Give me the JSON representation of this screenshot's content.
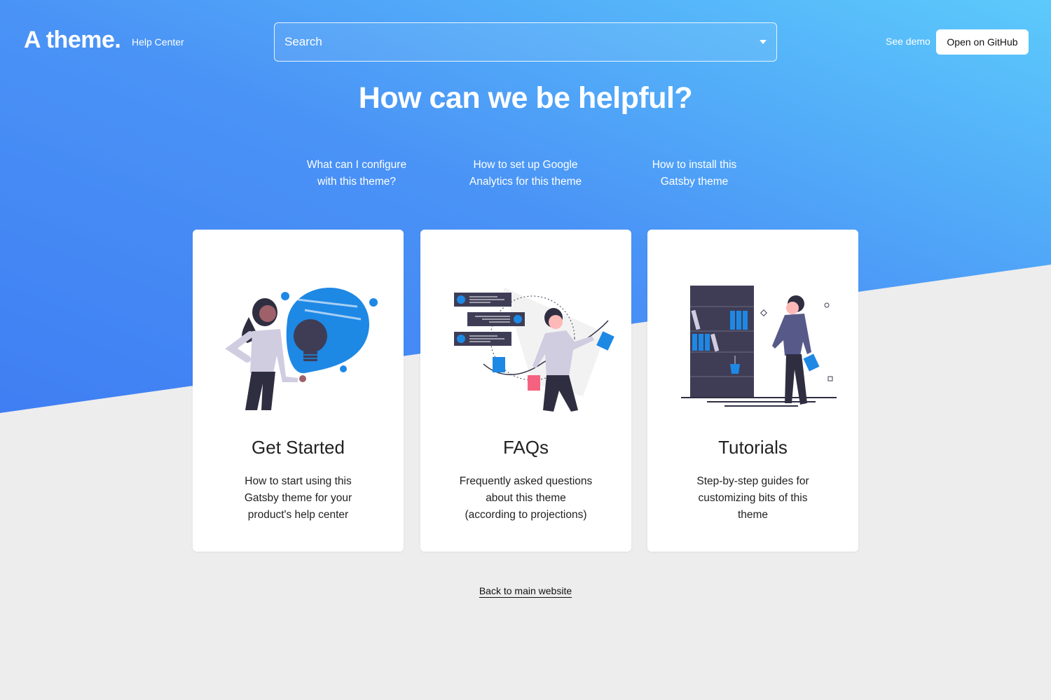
{
  "header": {
    "logo": "A theme.",
    "logo_sub": "Help Center",
    "search_placeholder": "Search",
    "see_demo": "See demo",
    "github_button": "Open on GitHub"
  },
  "hero": {
    "headline": "How can we be helpful?",
    "popular_links": [
      "What can I configure with this theme?",
      "How to set up Google Analytics for this theme",
      "How to install this Gatsby theme"
    ]
  },
  "cards": [
    {
      "title": "Get Started",
      "description": "How to start using this Gatsby theme for your product's help center"
    },
    {
      "title": "FAQs",
      "description": "Frequently asked questions about this theme (according to projections)"
    },
    {
      "title": "Tutorials",
      "description": "Step-by-step guides for customizing bits of this theme"
    }
  ],
  "footer": {
    "back_link": "Back to main website"
  },
  "colors": {
    "gradient_start": "#4285f4",
    "gradient_end": "#5bc8fb",
    "accent": "#1e88e5",
    "page_bg": "#ededed"
  }
}
